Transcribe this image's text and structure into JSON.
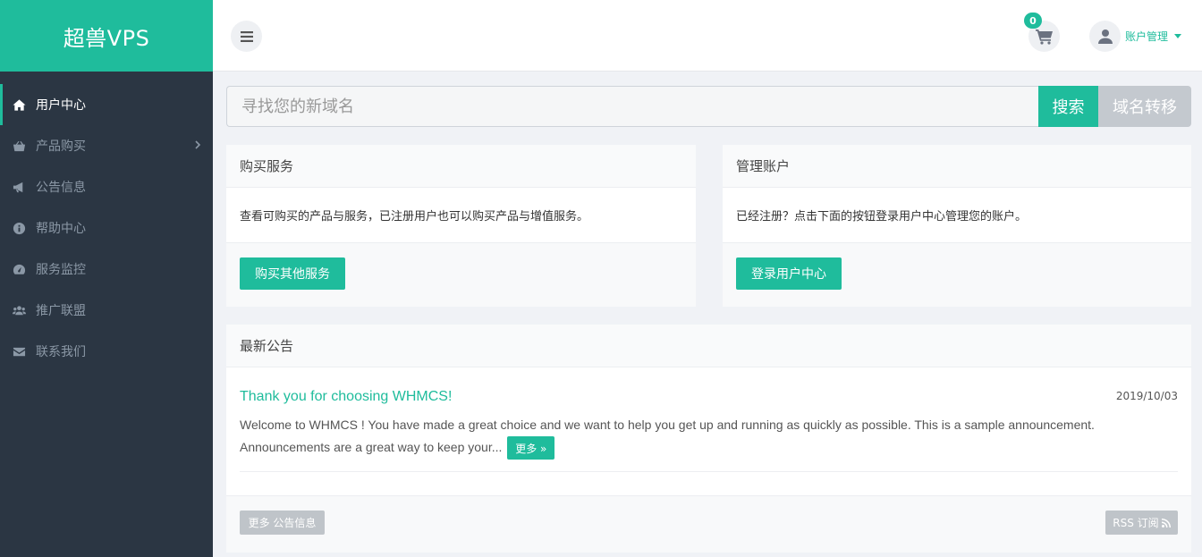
{
  "brand": {
    "name": "超兽VPS"
  },
  "sidebar": {
    "items": [
      {
        "label": "用户中心",
        "icon": "home-icon",
        "active": true
      },
      {
        "label": "产品购买",
        "icon": "basket-icon",
        "has_children": true
      },
      {
        "label": "公告信息",
        "icon": "bullhorn-icon"
      },
      {
        "label": "帮助中心",
        "icon": "info-icon"
      },
      {
        "label": "服务监控",
        "icon": "dashboard-icon"
      },
      {
        "label": "推广联盟",
        "icon": "users-icon"
      },
      {
        "label": "联系我们",
        "icon": "envelope-icon"
      }
    ]
  },
  "header": {
    "cart_count": "0",
    "account_label": "账户管理"
  },
  "search": {
    "placeholder": "寻找您的新域名",
    "search_label": "搜索",
    "transfer_label": "域名转移"
  },
  "buy_panel": {
    "title": "购买服务",
    "text": "查看可购买的产品与服务，已注册用户也可以购买产品与增值服务。",
    "button": "购买其他服务"
  },
  "account_panel": {
    "title": "管理账户",
    "text": "已经注册？点击下面的按钮登录用户中心管理您的账户。",
    "button": "登录用户中心"
  },
  "announcements": {
    "title": "最新公告",
    "items": [
      {
        "title": "Thank you for choosing WHMCS!",
        "date": "2019/10/03",
        "excerpt": "Welcome to WHMCS ! You have made a great choice and we want to help you get up and running as quickly as possible. This is a sample announcement. Announcements are a great way to keep your...",
        "more": "更多 »"
      }
    ],
    "more_button": "更多 公告信息",
    "rss_button": "RSS 订阅"
  },
  "colors": {
    "accent": "#1fbc9c",
    "sidebar_bg": "#2b3643",
    "grey_button": "#bfc4c9"
  }
}
